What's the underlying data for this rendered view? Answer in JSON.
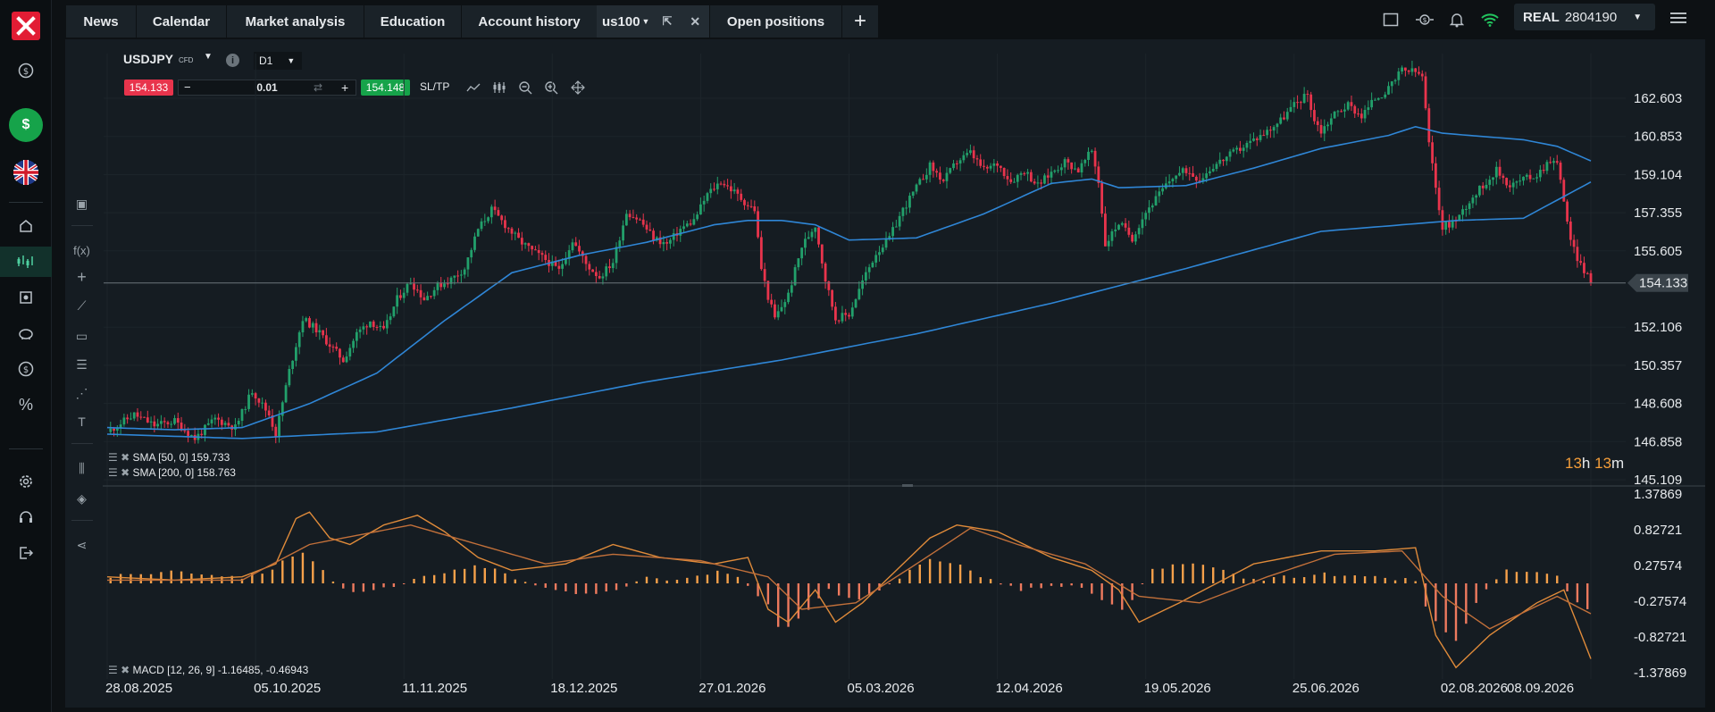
{
  "nav_tabs": [
    {
      "label": "News"
    },
    {
      "label": "Calendar"
    },
    {
      "label": "Market analysis"
    },
    {
      "label": "Education"
    },
    {
      "label": "Account history"
    },
    {
      "label": "us100"
    },
    {
      "label": "Open positions"
    }
  ],
  "account": {
    "type": "REAL",
    "number": "2804190"
  },
  "sidebar_icons": [
    "logo-icon",
    "dollar-icon",
    "deposit-icon",
    "uk-flag-icon",
    "home-icon",
    "chart-icon",
    "market-icon",
    "piggy-bank-icon",
    "savings-icon",
    "percent-icon",
    "settings-icon",
    "headset-icon",
    "logout-icon"
  ],
  "instrument": {
    "symbol": "USDJPY",
    "type": "CFD",
    "timeframe": "D1"
  },
  "trade": {
    "sell_price": "154.133",
    "buy_price": "154.148",
    "volume": "0.01",
    "sltp_label": "SL/TP"
  },
  "price_axis": [
    "162.603",
    "160.853",
    "159.104",
    "157.355",
    "155.605",
    "152.106",
    "150.357",
    "148.608",
    "146.858",
    "145.109"
  ],
  "current_price": "154.133",
  "countdown": {
    "hours": "13",
    "h": "h",
    "minutes": "13",
    "m": "m"
  },
  "indicators": {
    "sma50": "SMA [50, 0] 159.733",
    "sma200": "SMA [200, 0] 158.763",
    "macd": "MACD [12, 26, 9] -1.16485, -0.46943"
  },
  "macd_axis": [
    "1.37869",
    "0.82721",
    "0.27574",
    "-0.27574",
    "-0.82721",
    "-1.37869"
  ],
  "date_axis": [
    "28.08.2025",
    "05.10.2025",
    "11.11.2025",
    "18.12.2025",
    "27.01.2026",
    "05.03.2026",
    "12.04.2026",
    "19.05.2026",
    "25.06.2026",
    "02.08.2026",
    "08.09.2026"
  ],
  "colors": {
    "bull": "#22a06b",
    "bear": "#e8344c",
    "sma": "#2f86d6",
    "macd_hist": "#f5a04a",
    "macd_line": "#e08b3a"
  },
  "chart_data": {
    "type": "candlestick",
    "symbol": "USDJPY",
    "timeframe": "D1",
    "ylim": [
      145.109,
      162.603
    ],
    "x_range": [
      "28.08.2025",
      "08.09.2026"
    ],
    "close_path": [
      [
        0,
        147.3
      ],
      [
        8,
        148.1
      ],
      [
        14,
        147.6
      ],
      [
        20,
        147.8
      ],
      [
        26,
        147.0
      ],
      [
        32,
        147.9
      ],
      [
        38,
        147.5
      ],
      [
        43,
        149.2
      ],
      [
        48,
        148.1
      ],
      [
        50,
        147.2
      ],
      [
        54,
        150.1
      ],
      [
        58,
        152.5
      ],
      [
        62,
        152.0
      ],
      [
        66,
        151.3
      ],
      [
        70,
        150.6
      ],
      [
        74,
        151.8
      ],
      [
        78,
        152.4
      ],
      [
        82,
        151.9
      ],
      [
        86,
        153.4
      ],
      [
        90,
        154.2
      ],
      [
        94,
        153.4
      ],
      [
        98,
        154.0
      ],
      [
        102,
        154.3
      ],
      [
        106,
        154.8
      ],
      [
        110,
        156.6
      ],
      [
        114,
        157.5
      ],
      [
        118,
        156.8
      ],
      [
        122,
        156.1
      ],
      [
        126,
        155.6
      ],
      [
        130,
        155.2
      ],
      [
        134,
        154.7
      ],
      [
        138,
        156.1
      ],
      [
        142,
        155.0
      ],
      [
        146,
        154.4
      ],
      [
        150,
        155.1
      ],
      [
        154,
        157.4
      ],
      [
        158,
        157.0
      ],
      [
        162,
        156.2
      ],
      [
        166,
        155.9
      ],
      [
        170,
        156.6
      ],
      [
        174,
        157.0
      ],
      [
        178,
        158.2
      ],
      [
        182,
        158.8
      ],
      [
        186,
        158.3
      ],
      [
        190,
        157.7
      ],
      [
        192,
        157.5
      ],
      [
        194,
        154.8
      ],
      [
        196,
        153.5
      ],
      [
        198,
        152.5
      ],
      [
        202,
        153.6
      ],
      [
        206,
        155.8
      ],
      [
        210,
        156.8
      ],
      [
        213,
        154.3
      ],
      [
        216,
        152.5
      ],
      [
        220,
        152.7
      ],
      [
        224,
        154.2
      ],
      [
        228,
        155.5
      ],
      [
        232,
        156.2
      ],
      [
        236,
        157.5
      ],
      [
        240,
        158.5
      ],
      [
        244,
        159.5
      ],
      [
        248,
        158.8
      ],
      [
        252,
        159.7
      ],
      [
        256,
        160.1
      ],
      [
        260,
        159.3
      ],
      [
        264,
        159.6
      ],
      [
        268,
        158.8
      ],
      [
        272,
        159.3
      ],
      [
        276,
        158.6
      ],
      [
        280,
        159.2
      ],
      [
        284,
        159.7
      ],
      [
        288,
        159.3
      ],
      [
        292,
        160.2
      ],
      [
        294,
        158.8
      ],
      [
        296,
        155.9
      ],
      [
        300,
        156.9
      ],
      [
        304,
        156.2
      ],
      [
        308,
        157.4
      ],
      [
        312,
        158.2
      ],
      [
        316,
        159.0
      ],
      [
        320,
        159.3
      ],
      [
        324,
        158.9
      ],
      [
        328,
        159.5
      ],
      [
        332,
        159.9
      ],
      [
        336,
        160.3
      ],
      [
        340,
        160.7
      ],
      [
        344,
        161.1
      ],
      [
        348,
        161.6
      ],
      [
        352,
        162.3
      ],
      [
        356,
        162.8
      ],
      [
        358,
        161.6
      ],
      [
        360,
        161.1
      ],
      [
        364,
        161.9
      ],
      [
        368,
        162.3
      ],
      [
        372,
        161.8
      ],
      [
        376,
        162.6
      ],
      [
        380,
        163.0
      ],
      [
        384,
        163.9
      ],
      [
        388,
        163.8
      ],
      [
        390,
        163.6
      ],
      [
        392,
        160.5
      ],
      [
        394,
        158.5
      ],
      [
        396,
        156.7
      ],
      [
        400,
        157.0
      ],
      [
        404,
        157.9
      ],
      [
        408,
        158.6
      ],
      [
        412,
        159.3
      ],
      [
        416,
        158.6
      ],
      [
        420,
        158.9
      ],
      [
        424,
        159.1
      ],
      [
        428,
        159.8
      ],
      [
        430,
        159.6
      ],
      [
        432,
        158.0
      ],
      [
        434,
        156.0
      ],
      [
        436,
        155.3
      ],
      [
        438,
        154.7
      ],
      [
        440,
        154.133
      ]
    ],
    "sma50_path": [
      [
        0,
        147.5
      ],
      [
        20,
        147.4
      ],
      [
        40,
        147.5
      ],
      [
        60,
        148.6
      ],
      [
        80,
        150.0
      ],
      [
        100,
        152.4
      ],
      [
        120,
        154.6
      ],
      [
        140,
        155.4
      ],
      [
        160,
        156.0
      ],
      [
        180,
        156.8
      ],
      [
        190,
        157.0
      ],
      [
        200,
        157.0
      ],
      [
        210,
        156.8
      ],
      [
        220,
        156.1
      ],
      [
        240,
        156.2
      ],
      [
        260,
        157.3
      ],
      [
        280,
        158.7
      ],
      [
        292,
        158.9
      ],
      [
        300,
        158.5
      ],
      [
        320,
        158.6
      ],
      [
        340,
        159.4
      ],
      [
        360,
        160.3
      ],
      [
        380,
        160.9
      ],
      [
        388,
        161.3
      ],
      [
        396,
        161.0
      ],
      [
        420,
        160.7
      ],
      [
        430,
        160.4
      ],
      [
        440,
        159.733
      ]
    ],
    "sma200_path": [
      [
        0,
        147.2
      ],
      [
        40,
        147.0
      ],
      [
        80,
        147.3
      ],
      [
        120,
        148.4
      ],
      [
        160,
        149.6
      ],
      [
        200,
        150.6
      ],
      [
        240,
        151.8
      ],
      [
        280,
        153.2
      ],
      [
        320,
        154.8
      ],
      [
        360,
        156.5
      ],
      [
        400,
        157.0
      ],
      [
        420,
        157.1
      ],
      [
        440,
        158.763
      ]
    ],
    "macd": {
      "ylim": [
        -1.37869,
        1.37869
      ],
      "hist_path": [
        [
          0,
          0.1
        ],
        [
          20,
          0.2
        ],
        [
          30,
          0.15
        ],
        [
          40,
          0.1
        ],
        [
          48,
          0.2
        ],
        [
          54,
          0.4
        ],
        [
          58,
          0.5
        ],
        [
          62,
          0.3
        ],
        [
          66,
          0.1
        ],
        [
          70,
          -0.1
        ],
        [
          76,
          -0.15
        ],
        [
          86,
          -0.05
        ],
        [
          94,
          0.1
        ],
        [
          100,
          0.15
        ],
        [
          110,
          0.3
        ],
        [
          120,
          0.1
        ],
        [
          130,
          -0.05
        ],
        [
          140,
          -0.2
        ],
        [
          150,
          -0.1
        ],
        [
          160,
          0.1
        ],
        [
          170,
          0.05
        ],
        [
          176,
          0.1
        ],
        [
          182,
          0.2
        ],
        [
          188,
          0.05
        ],
        [
          196,
          -0.3
        ],
        [
          200,
          -0.8
        ],
        [
          206,
          -0.5
        ],
        [
          214,
          -0.1
        ],
        [
          222,
          -0.3
        ],
        [
          230,
          -0.1
        ],
        [
          238,
          0.2
        ],
        [
          244,
          0.4
        ],
        [
          252,
          0.3
        ],
        [
          260,
          0.1
        ],
        [
          270,
          -0.1
        ],
        [
          280,
          -0.05
        ],
        [
          288,
          -0.05
        ],
        [
          296,
          -0.3
        ],
        [
          302,
          -0.4
        ],
        [
          310,
          0.2
        ],
        [
          318,
          0.3
        ],
        [
          328,
          0.25
        ],
        [
          340,
          0.05
        ],
        [
          350,
          0.1
        ],
        [
          360,
          0.15
        ],
        [
          370,
          0.1
        ],
        [
          380,
          0.08
        ],
        [
          388,
          0.05
        ],
        [
          392,
          -0.5
        ],
        [
          400,
          -0.9
        ],
        [
          406,
          -0.3
        ],
        [
          414,
          0.2
        ],
        [
          424,
          0.15
        ],
        [
          430,
          0.1
        ],
        [
          436,
          -0.3
        ],
        [
          440,
          -0.46943
        ]
      ],
      "macd_path": [
        [
          0,
          0.1
        ],
        [
          20,
          0.05
        ],
        [
          40,
          0.1
        ],
        [
          50,
          0.3
        ],
        [
          56,
          1.0
        ],
        [
          60,
          1.1
        ],
        [
          66,
          0.7
        ],
        [
          72,
          0.6
        ],
        [
          82,
          0.9
        ],
        [
          92,
          1.05
        ],
        [
          100,
          0.8
        ],
        [
          110,
          0.4
        ],
        [
          120,
          0.2
        ],
        [
          136,
          0.3
        ],
        [
          150,
          0.6
        ],
        [
          164,
          0.4
        ],
        [
          180,
          0.3
        ],
        [
          190,
          0.4
        ],
        [
          196,
          -0.4
        ],
        [
          202,
          -0.6
        ],
        [
          210,
          -0.1
        ],
        [
          216,
          -0.6
        ],
        [
          224,
          -0.3
        ],
        [
          234,
          0.2
        ],
        [
          244,
          0.7
        ],
        [
          252,
          0.9
        ],
        [
          264,
          0.8
        ],
        [
          280,
          0.4
        ],
        [
          292,
          0.2
        ],
        [
          300,
          -0.1
        ],
        [
          306,
          -0.6
        ],
        [
          318,
          -0.3
        ],
        [
          340,
          0.3
        ],
        [
          360,
          0.5
        ],
        [
          376,
          0.5
        ],
        [
          388,
          0.55
        ],
        [
          394,
          -0.8
        ],
        [
          400,
          -1.3
        ],
        [
          410,
          -0.8
        ],
        [
          424,
          -0.3
        ],
        [
          432,
          -0.1
        ],
        [
          440,
          -1.16485
        ]
      ],
      "signal_path": [
        [
          0,
          0.05
        ],
        [
          40,
          0.05
        ],
        [
          60,
          0.6
        ],
        [
          70,
          0.7
        ],
        [
          90,
          0.9
        ],
        [
          110,
          0.6
        ],
        [
          130,
          0.3
        ],
        [
          150,
          0.45
        ],
        [
          176,
          0.35
        ],
        [
          196,
          0.1
        ],
        [
          206,
          -0.4
        ],
        [
          222,
          -0.3
        ],
        [
          240,
          0.3
        ],
        [
          256,
          0.85
        ],
        [
          270,
          0.6
        ],
        [
          290,
          0.3
        ],
        [
          306,
          -0.2
        ],
        [
          324,
          -0.3
        ],
        [
          344,
          0.1
        ],
        [
          364,
          0.45
        ],
        [
          384,
          0.5
        ],
        [
          396,
          -0.2
        ],
        [
          410,
          -0.7
        ],
        [
          430,
          -0.2
        ],
        [
          440,
          -0.46943
        ]
      ]
    }
  }
}
